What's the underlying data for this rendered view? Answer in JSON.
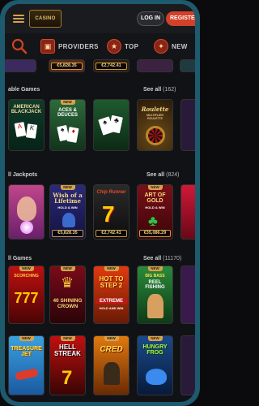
{
  "header": {
    "logo_text": "CASINO",
    "login_label": "LOG IN",
    "register_label": "REGISTER"
  },
  "nav": {
    "items": [
      {
        "label": "PROVIDERS",
        "icon": "providers-icon"
      },
      {
        "label": "TOP",
        "icon": "star-icon"
      },
      {
        "label": "NEW",
        "icon": "flame-icon"
      }
    ]
  },
  "top_row": {
    "jackpots": [
      "€5,828.35",
      "€2,742.41"
    ]
  },
  "table_games": {
    "title": "able Games",
    "see_all": "See all",
    "count": "(162)",
    "games": [
      {
        "title": "AMERICAN BLACKJACK"
      },
      {
        "title": "ACES & DEUCES",
        "new": true
      },
      {
        "title": ""
      },
      {
        "title": "Roulette",
        "subtitle": "MULTIPLIER ROULETTE"
      }
    ]
  },
  "jackpots": {
    "title": "ll Jackpots",
    "see_all": "See all",
    "count": "(824)",
    "games": [
      {
        "title": "",
        "jackpot": ""
      },
      {
        "title": "Wish of a Lifetime",
        "subtitle": "HOLD & WIN",
        "new": true,
        "jackpot": "€5,828.35"
      },
      {
        "title": "Chip Runner",
        "jackpot": "€2,742.41"
      },
      {
        "title": "ART OF GOLD",
        "subtitle": "HOLD & WIN",
        "new": true,
        "jackpot": "€35,086.29"
      },
      {
        "title": "",
        "jackpot": ""
      }
    ]
  },
  "all_games": {
    "title": "ll Games",
    "see_all": "See all",
    "count": "(11170)",
    "row1": [
      {
        "title": "777",
        "subtitle": "SCORCHING",
        "new": true
      },
      {
        "title": "40 SHINING CROWN",
        "new": true
      },
      {
        "title": "HOT TO STEP 2",
        "subtitle": "EXTREME",
        "tag": "HOLD AND WIN",
        "new": true
      },
      {
        "title": "REEL FISHING",
        "subtitle": "BIG BASS",
        "new": true
      }
    ],
    "row2": [
      {
        "title": "TREASURE JET",
        "new": true
      },
      {
        "title": "HELL STREAK",
        "new": true
      },
      {
        "title": "CRED",
        "new": true
      },
      {
        "title": "HUNGRY FROG",
        "new": true
      }
    ]
  }
}
